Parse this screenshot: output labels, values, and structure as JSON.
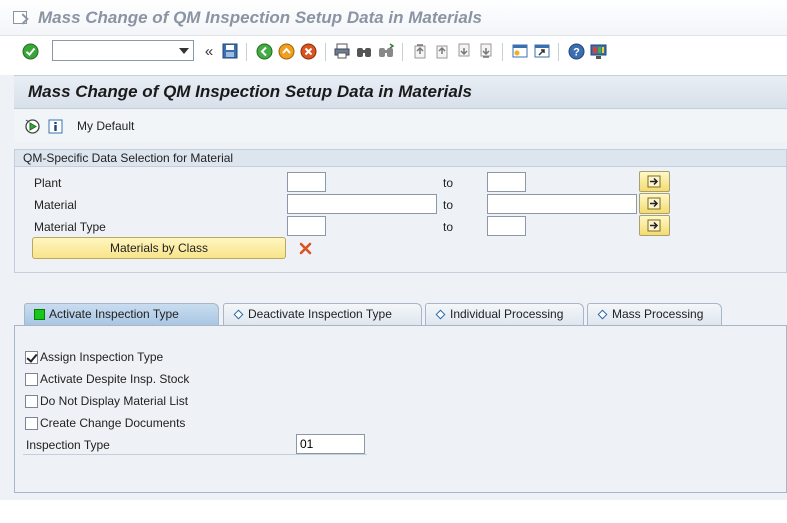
{
  "window": {
    "title": "Mass Change of QM Inspection Setup Data in Materials"
  },
  "toolbar": {
    "command_value": "",
    "icons": [
      "enter-icon",
      "command-field",
      "fast-back-icon",
      "save-icon",
      "back-icon",
      "exit-icon",
      "cancel-icon",
      "print-icon",
      "find-icon",
      "find-next-icon",
      "first-page-icon",
      "previous-page-icon",
      "next-page-icon",
      "last-page-icon",
      "create-session-icon",
      "shortcut-icon",
      "help-icon",
      "customize-layout-icon"
    ]
  },
  "page": {
    "title": "Mass Change of QM Inspection Setup Data in Materials",
    "variant_label": "My Default"
  },
  "selection": {
    "group_title": "QM-Specific Data Selection for Material",
    "to_label": "to",
    "rows": [
      {
        "label": "Plant",
        "from": "",
        "to": ""
      },
      {
        "label": "Material",
        "from": "",
        "to": ""
      },
      {
        "label": "Material Type",
        "from": "",
        "to": ""
      }
    ],
    "class_button": "Materials by Class"
  },
  "tabs": [
    {
      "label": "Activate Inspection Type",
      "active": true
    },
    {
      "label": "Deactivate Inspection Type",
      "active": false
    },
    {
      "label": "Individual Processing",
      "active": false
    },
    {
      "label": "Mass Processing",
      "active": false
    }
  ],
  "options": [
    {
      "label": "Assign Inspection Type",
      "checked": true
    },
    {
      "label": "Activate Despite Insp. Stock",
      "checked": false
    },
    {
      "label": "Do Not Display Material List",
      "checked": false
    },
    {
      "label": "Create Change Documents",
      "checked": false
    }
  ],
  "inspection_type": {
    "label": "Inspection Type",
    "value": "01"
  },
  "colors": {
    "accent_yellow": "#f8e48a",
    "active_tab": "#a9c6e2",
    "green_status": "#17c817",
    "delete_red": "#d9541e"
  }
}
